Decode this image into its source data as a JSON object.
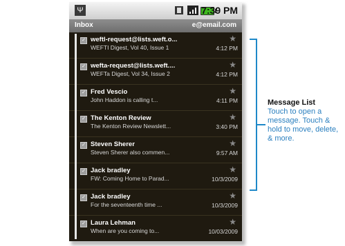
{
  "status_bar": {
    "time": "7:39 PM"
  },
  "title_bar": {
    "folder": "Inbox",
    "account": "e@email.com"
  },
  "messages": [
    {
      "sender": "weftl-request@lists.weft.o...",
      "preview": "WEFTI Digest, Vol 40, Issue 1",
      "time": "4:12 PM"
    },
    {
      "sender": "wefta-request@lists.weft....",
      "preview": "WEFTa Digest, Vol 34, Issue 2",
      "time": "4:12 PM"
    },
    {
      "sender": "Fred Vescio",
      "preview": "John Haddon is calling t...",
      "time": "4:11 PM"
    },
    {
      "sender": "The Kenton Review",
      "preview": "The Kenton Review Newslett...",
      "time": "3:40 PM"
    },
    {
      "sender": "Steven Sherer",
      "preview": "Steven Sherer also commen...",
      "time": "9:57 AM"
    },
    {
      "sender": "Jack bradley",
      "preview": "FW: Coming Home to Parad...",
      "time": "10/3/2009"
    },
    {
      "sender": "Jack bradley",
      "preview": "For the seventeenth time ...",
      "time": "10/3/2009"
    },
    {
      "sender": "Laura Lehman",
      "preview": "When are you coming to...",
      "time": "10/03/2009"
    }
  ],
  "caption": {
    "title": "Message List",
    "body": "Touch to open a message. Touch & hold to move, delete, & more."
  },
  "colors": {
    "accent": "#1e88c8",
    "list_bg": "#1f1a10",
    "battery": "#3db81e"
  }
}
